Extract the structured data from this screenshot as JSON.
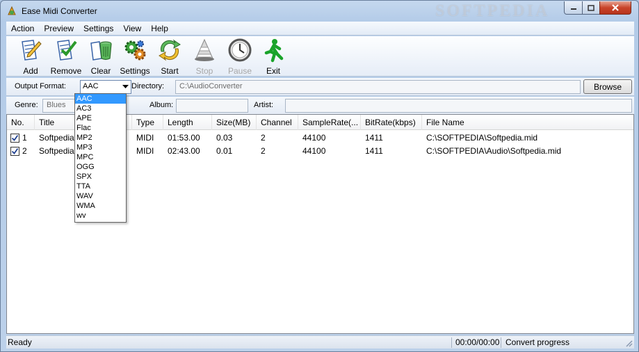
{
  "window": {
    "title": "Ease Midi Converter",
    "watermark": "SOFTPEDIA"
  },
  "menu": [
    "Action",
    "Preview",
    "Settings",
    "View",
    "Help"
  ],
  "toolbar": [
    {
      "label": "Add",
      "icon": "add-document-icon",
      "enabled": true
    },
    {
      "label": "Remove",
      "icon": "remove-document-icon",
      "enabled": true
    },
    {
      "label": "Clear",
      "icon": "trash-icon",
      "enabled": true
    },
    {
      "label": "Settings",
      "icon": "gears-icon",
      "enabled": true
    },
    {
      "label": "Start",
      "icon": "start-arrows-icon",
      "enabled": true
    },
    {
      "label": "Stop",
      "icon": "stop-cone-icon",
      "enabled": false
    },
    {
      "label": "Pause",
      "icon": "clock-icon",
      "enabled": false
    },
    {
      "label": "Exit",
      "icon": "running-man-icon",
      "enabled": true
    }
  ],
  "options": {
    "output_format_label": "Output Format:",
    "output_format_value": "AAC",
    "directory_label": "Directory:",
    "directory_value": "C:\\AudioConverter",
    "browse_label": "Browse",
    "genre_label": "Genre:",
    "genre_value": "Blues",
    "album_label": "Album:",
    "album_value": "",
    "artist_label": "Artist:",
    "artist_value": ""
  },
  "format_options": [
    "AAC",
    "AC3",
    "APE",
    "Flac",
    "MP2",
    "MP3",
    "MPC",
    "OGG",
    "SPX",
    "TTA",
    "WAV",
    "WMA",
    "wv"
  ],
  "table": {
    "columns": [
      "No.",
      "Title",
      "Type",
      "Length",
      "Size(MB)",
      "Channel",
      "SampleRate(...",
      "BitRate(kbps)",
      "File Name"
    ],
    "rows": [
      {
        "checked": true,
        "no": "1",
        "title": "Softpedia",
        "type": "MIDI",
        "length": "01:53.00",
        "size": "0.03",
        "channel": "2",
        "samplerate": "44100",
        "bitrate": "1411",
        "file": "C:\\SOFTPEDIA\\Softpedia.mid"
      },
      {
        "checked": true,
        "no": "2",
        "title": "Softpedia",
        "type": "MIDI",
        "length": "02:43.00",
        "size": "0.01",
        "channel": "2",
        "samplerate": "44100",
        "bitrate": "1411",
        "file": "C:\\SOFTPEDIA\\Audio\\Softpedia.mid"
      }
    ]
  },
  "status": {
    "state": "Ready",
    "time": "00:00/00:00",
    "progress_label": "Convert progress"
  },
  "colors": {
    "selection": "#3399ff",
    "exit_green": "#1aa32a"
  }
}
